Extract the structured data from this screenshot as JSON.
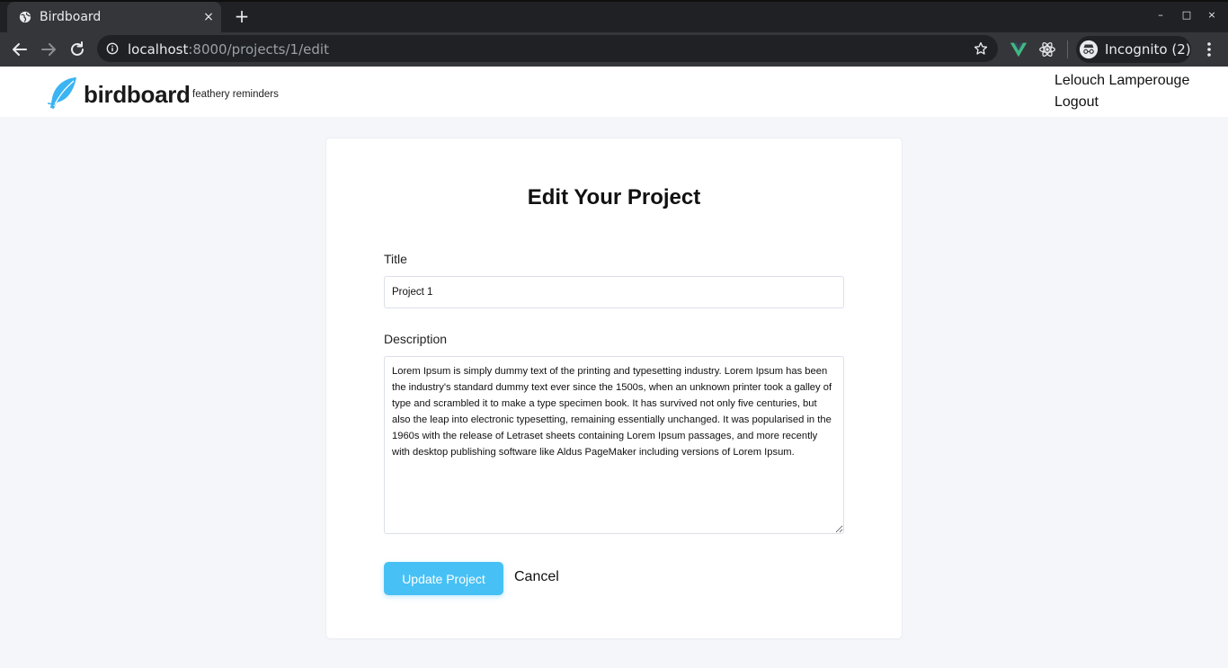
{
  "browser": {
    "tab_title": "Birdboard",
    "tab_close": "×",
    "new_tab": "+",
    "url_host": "localhost",
    "url_path": ":8000/projects/1/edit",
    "incognito_label": "Incognito (2)",
    "window_controls": {
      "minimize": "–",
      "maximize": "□",
      "close": "×"
    },
    "colors": {
      "frame": "#202124",
      "toolbar": "#35363a",
      "vue_ext": "#41b883"
    }
  },
  "header": {
    "logo_word": "birdboard",
    "tagline": "feathery reminders",
    "user_name": "Lelouch Lamperouge",
    "logout_label": "Logout",
    "colors": {
      "logo": "#3ab4f2"
    }
  },
  "form": {
    "heading": "Edit Your Project",
    "title_label": "Title",
    "title_value": "Project 1",
    "description_label": "Description",
    "description_value": "Lorem Ipsum is simply dummy text of the printing and typesetting industry. Lorem Ipsum has been the industry's standard dummy text ever since the 1500s, when an unknown printer took a galley of type and scrambled it to make a type specimen book. It has survived not only five centuries, but also the leap into electronic typesetting, remaining essentially unchanged. It was popularised in the 1960s with the release of Letraset sheets containing Lorem Ipsum passages, and more recently with desktop publishing software like Aldus PageMaker including versions of Lorem Ipsum.",
    "submit_label": "Update Project",
    "cancel_label": "Cancel",
    "colors": {
      "button": "#47c1f5",
      "page_bg": "#f5f6fa"
    }
  }
}
